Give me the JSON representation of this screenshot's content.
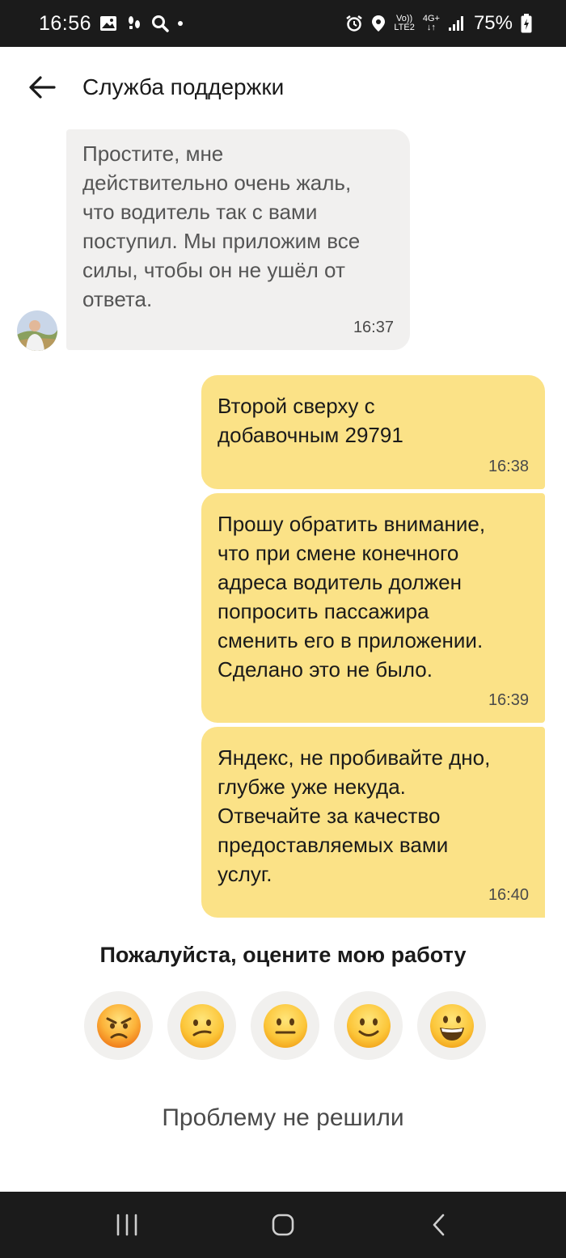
{
  "status_bar": {
    "time": "16:56",
    "network_top": "Vo))",
    "network_bottom": "LTE2",
    "net_type": "4G+",
    "battery_percent": "75%",
    "icons": [
      "image-icon",
      "steps-icon",
      "search-icon",
      "dot-icon",
      "alarm-icon",
      "location-icon",
      "signal-icon",
      "battery-icon"
    ]
  },
  "app_bar": {
    "title": "Служба поддержки",
    "back_icon": "arrow-left-icon"
  },
  "messages": [
    {
      "direction": "incoming",
      "text": "Простите, мне\nдействительно очень жаль,\nчто водитель так с вами\nпоступил. Мы приложим все\nсилы, чтобы он не ушёл от\nответа.",
      "time": "16:37"
    },
    {
      "direction": "outgoing",
      "text": "Второй сверху с\nдобавочным 29791",
      "time": "16:38"
    },
    {
      "direction": "outgoing",
      "text": "Прошу обратить внимание,\nчто при смене конечного\nадреса водитель должен\nпопросить пассажира\nсменить его в приложении.\nСделано это не было.",
      "time": "16:39"
    },
    {
      "direction": "outgoing",
      "text": "Яндекс, не пробивайте дно,\nглубже уже некуда.\nОтвечайте за качество\nпредоставляемых вами\nуслуг.",
      "time": "16:40"
    }
  ],
  "rating": {
    "title": "Пожалуйста, оцените мою работу",
    "options": [
      "angry-face-icon",
      "confused-face-icon",
      "neutral-face-icon",
      "slight-smile-icon",
      "grinning-face-icon"
    ]
  },
  "problem_link": "Проблему не решили",
  "nav_bar": {
    "buttons": [
      "recent-apps-icon",
      "home-icon",
      "back-icon"
    ]
  },
  "colors": {
    "incoming_bubble": "#f1f0ef",
    "outgoing_bubble": "#fbe287",
    "system_bars": "#1b1b1b"
  }
}
